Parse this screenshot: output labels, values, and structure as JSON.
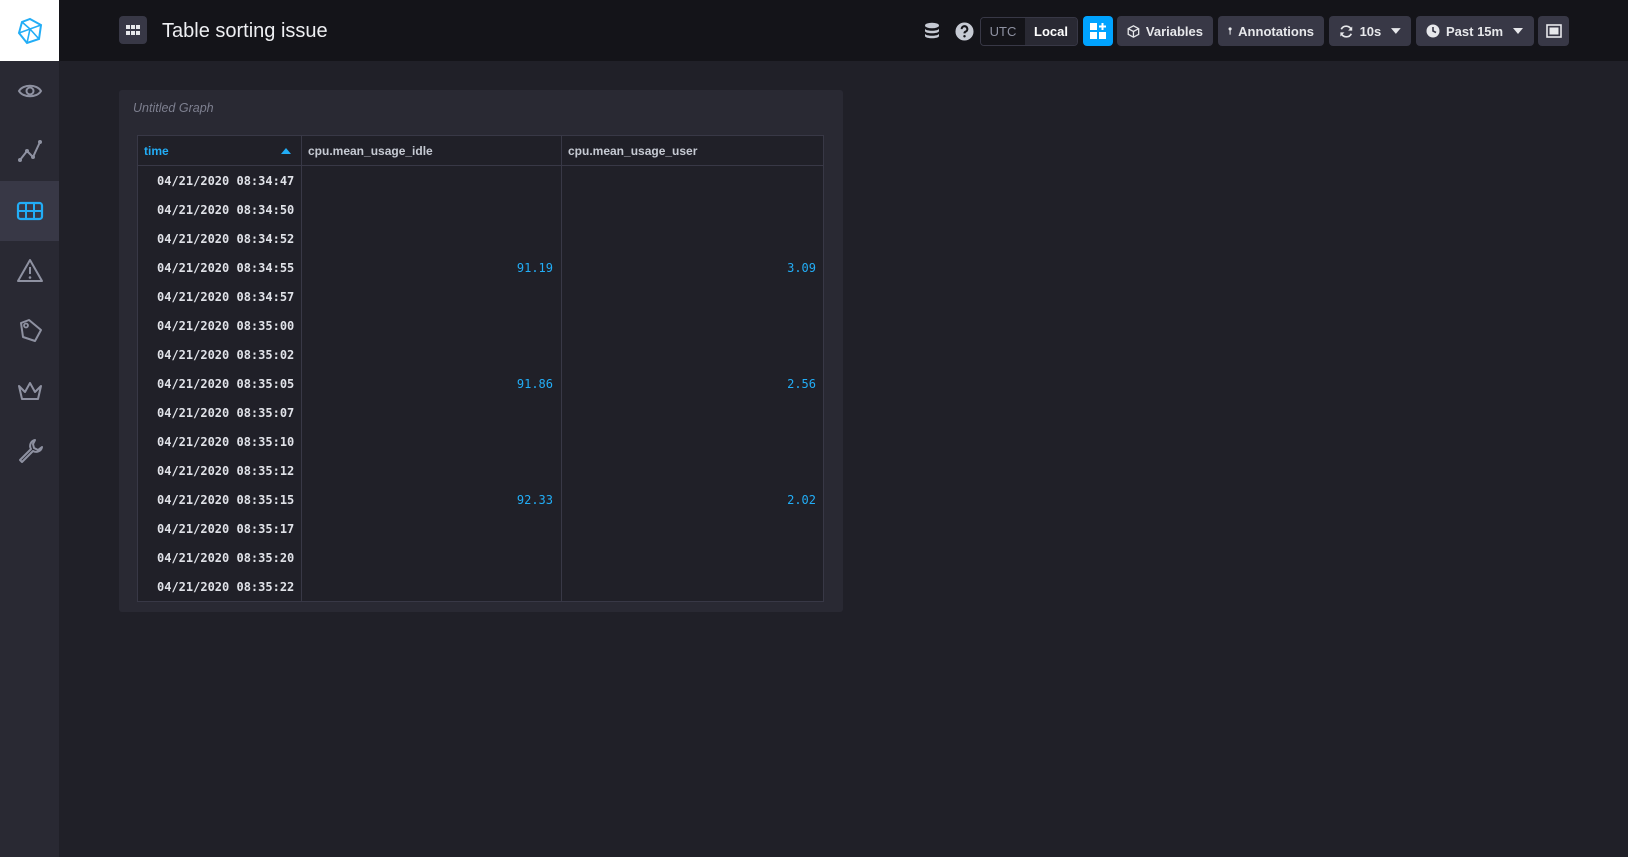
{
  "header": {
    "title": "Table sorting issue",
    "tz_utc": "UTC",
    "tz_local": "Local",
    "variables_label": "Variables",
    "annotations_label": "Annotations",
    "refresh_label": "10s",
    "timerange_label": "Past 15m"
  },
  "sidebar": {
    "items": [
      "eye-icon",
      "graph-icon",
      "table-icon",
      "alert-icon",
      "tag-icon",
      "crown-icon",
      "wrench-icon"
    ],
    "active": "table-icon"
  },
  "cell": {
    "title": "Untitled Graph",
    "columns": [
      "time",
      "cpu.mean_usage_idle",
      "cpu.mean_usage_user"
    ],
    "rows": [
      [
        "04/21/2020 08:34:47",
        "",
        ""
      ],
      [
        "04/21/2020 08:34:50",
        "",
        ""
      ],
      [
        "04/21/2020 08:34:52",
        "",
        ""
      ],
      [
        "04/21/2020 08:34:55",
        "91.19",
        "3.09"
      ],
      [
        "04/21/2020 08:34:57",
        "",
        ""
      ],
      [
        "04/21/2020 08:35:00",
        "",
        ""
      ],
      [
        "04/21/2020 08:35:02",
        "",
        ""
      ],
      [
        "04/21/2020 08:35:05",
        "91.86",
        "2.56"
      ],
      [
        "04/21/2020 08:35:07",
        "",
        ""
      ],
      [
        "04/21/2020 08:35:10",
        "",
        ""
      ],
      [
        "04/21/2020 08:35:12",
        "",
        ""
      ],
      [
        "04/21/2020 08:35:15",
        "92.33",
        "2.02"
      ],
      [
        "04/21/2020 08:35:17",
        "",
        ""
      ],
      [
        "04/21/2020 08:35:20",
        "",
        ""
      ],
      [
        "04/21/2020 08:35:22",
        "",
        ""
      ]
    ]
  },
  "colors": {
    "accent": "#00a3ff",
    "value": "#22adf6"
  }
}
